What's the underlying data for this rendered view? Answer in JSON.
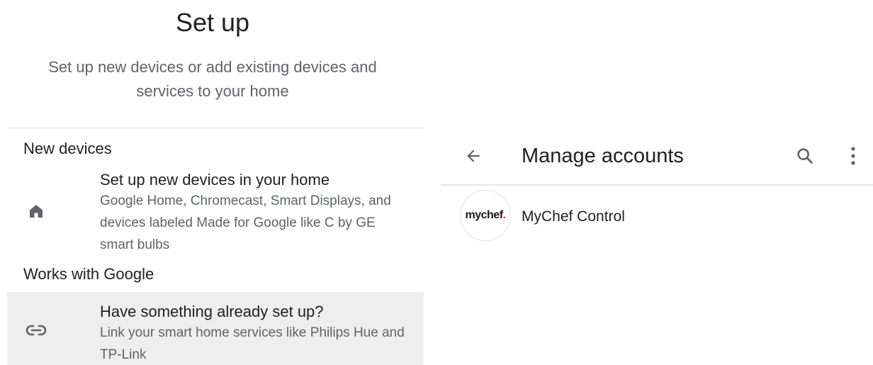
{
  "setup": {
    "title": "Set up",
    "subtitle": "Set up new devices or add existing devices and services to your home",
    "sections": {
      "new_devices": {
        "heading": "New devices",
        "item": {
          "icon": "home-icon",
          "title": "Set up new devices in your home",
          "description": "Google Home, Chromecast, Smart Displays, and devices labeled Made for Google like C by GE smart bulbs"
        }
      },
      "works_with_google": {
        "heading": "Works with Google",
        "item": {
          "icon": "link-icon",
          "title": "Have something already set up?",
          "description": "Link your smart home services like Philips Hue and TP-Link"
        }
      }
    }
  },
  "accounts": {
    "title": "Manage accounts",
    "icons": {
      "back": "arrow-back-icon",
      "search": "search-icon",
      "more": "more-vertical-icon"
    },
    "items": [
      {
        "logo_text": "mychef",
        "logo_dot": ".",
        "name": "MyChef Control"
      }
    ]
  },
  "colors": {
    "text_primary": "#202124",
    "text_secondary": "#5f6368",
    "highlight_row": "#eeeeee",
    "divider": "#dadce0",
    "logo_accent": "#e3204f"
  }
}
